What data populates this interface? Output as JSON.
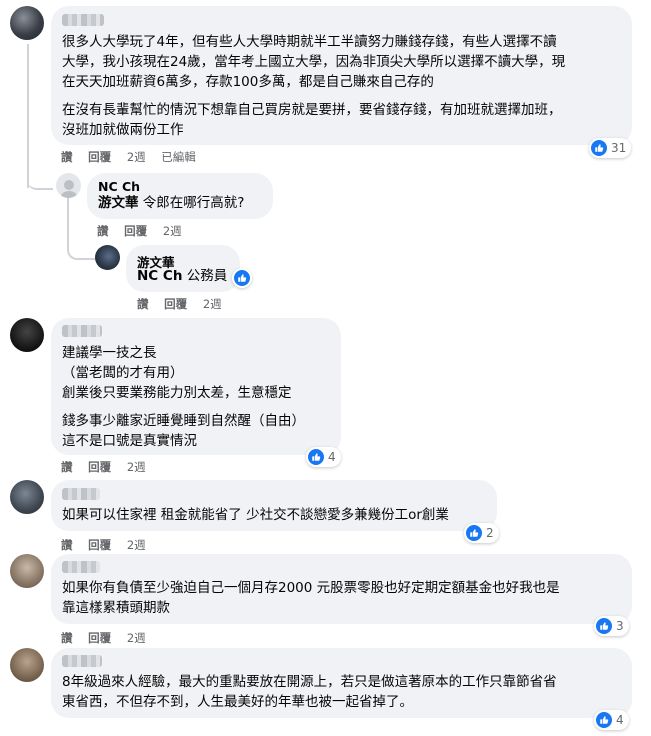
{
  "action_labels": {
    "like": "讚",
    "reply": "回覆",
    "edited": "已編輯"
  },
  "comments": [
    {
      "lines_p1": [
        "很多人大學玩了4年，但有些人大學時期就半工半讀努力賺錢存錢，有些人選擇不讀",
        "大學，我小孩現在24歲，當年考上國立大學，因為非頂尖大學所以選擇不讀大學，現",
        "在天天加班薪資6萬多，存款100多萬，都是自己賺來自己存的"
      ],
      "lines_p2": [
        "在沒有長輩幫忙的情況下想靠自己買房就是要拼，要省錢存錢，有加班就選擇加班，",
        "沒班加就做兩份工作"
      ],
      "time": "2週",
      "reactions": "31"
    },
    {
      "replies": [
        {
          "author": "NC Ch",
          "tag": "游文華",
          "body": " 令郎在哪行高就?",
          "time": "2週"
        },
        {
          "author": "游文華",
          "tag": "NC Ch",
          "body": " 公務員",
          "time": "2週"
        }
      ]
    },
    {
      "lines_p1": [
        "建議學一技之長",
        "（當老闆的才有用）",
        "創業後只要業務能力別太差，生意穩定"
      ],
      "lines_p2": [
        "錢多事少離家近睡覺睡到自然醒（自由）",
        "這不是口號是真實情況"
      ],
      "time": "2週",
      "reactions": "4"
    },
    {
      "lines_p1": [
        "如果可以住家裡 租金就能省了 少社交不談戀愛多兼幾份工or創業"
      ],
      "time": "2週",
      "reactions": "2"
    },
    {
      "lines_p1": [
        "如果你有負債至少強迫自己一個月存2000 元股票零股也好定期定額基金也好我也是",
        "靠這樣累積頭期款"
      ],
      "time": "2週",
      "reactions": "3"
    },
    {
      "lines_p1": [
        "8年級過來人經驗，最大的重點要放在開源上，若只是做這著原本的工作只靠節省省",
        "東省西，不但存不到，人生最美好的年華也被一起省掉了。"
      ],
      "time": "2週",
      "reactions": "4"
    }
  ]
}
